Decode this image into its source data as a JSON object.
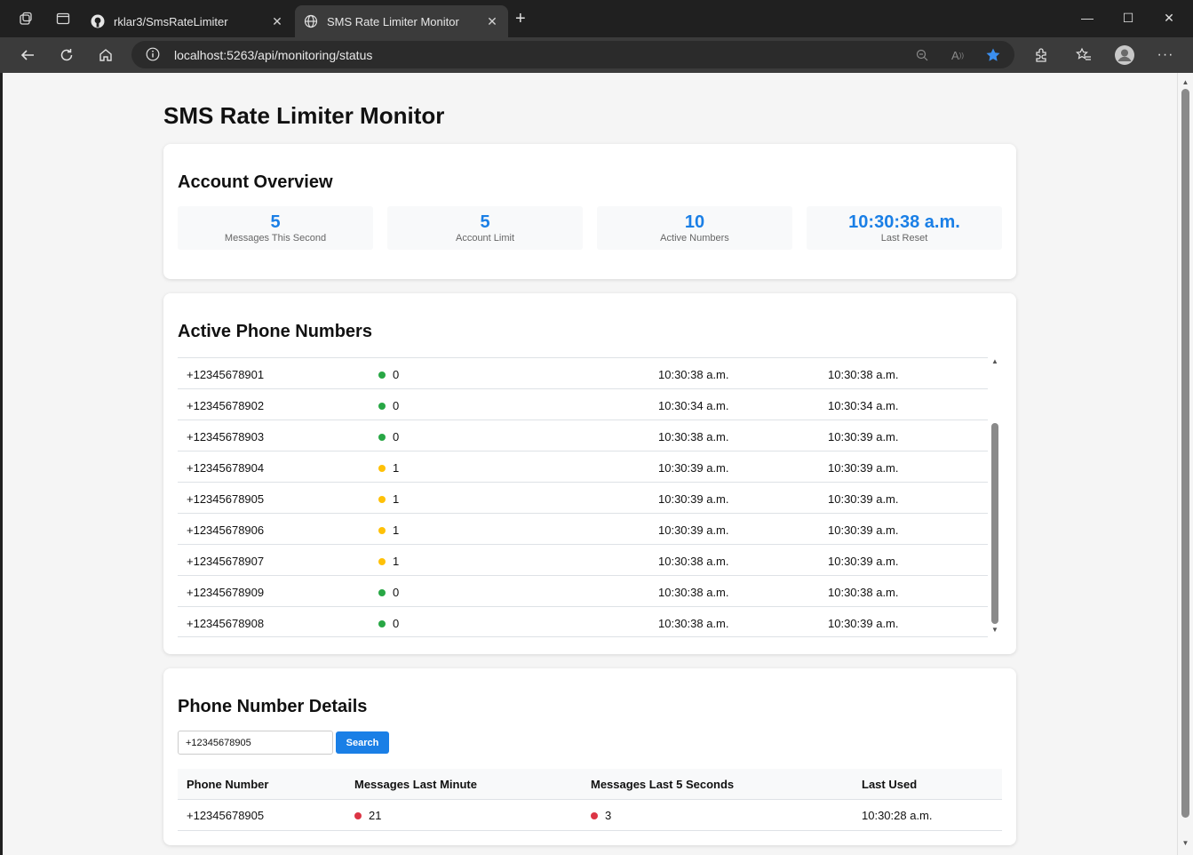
{
  "browser": {
    "tabs": [
      {
        "title": "rklar3/SmsRateLimiter",
        "active": false
      },
      {
        "title": "SMS Rate Limiter Monitor",
        "active": true
      }
    ],
    "url": "localhost:5263/api/monitoring/status"
  },
  "page": {
    "title": "SMS Rate Limiter Monitor"
  },
  "overview": {
    "title": "Account Overview",
    "stats": [
      {
        "value": "5",
        "label": "Messages This Second"
      },
      {
        "value": "5",
        "label": "Account Limit"
      },
      {
        "value": "10",
        "label": "Active Numbers"
      },
      {
        "value": "10:30:38 a.m.",
        "label": "Last Reset"
      }
    ]
  },
  "active_numbers": {
    "title": "Active Phone Numbers",
    "rows": [
      {
        "number": "+12345678901",
        "count": "0",
        "status": "green",
        "t1": "10:30:38 a.m.",
        "t2": "10:30:38 a.m."
      },
      {
        "number": "+12345678902",
        "count": "0",
        "status": "green",
        "t1": "10:30:34 a.m.",
        "t2": "10:30:34 a.m."
      },
      {
        "number": "+12345678903",
        "count": "0",
        "status": "green",
        "t1": "10:30:38 a.m.",
        "t2": "10:30:39 a.m."
      },
      {
        "number": "+12345678904",
        "count": "1",
        "status": "yellow",
        "t1": "10:30:39 a.m.",
        "t2": "10:30:39 a.m."
      },
      {
        "number": "+12345678905",
        "count": "1",
        "status": "yellow",
        "t1": "10:30:39 a.m.",
        "t2": "10:30:39 a.m."
      },
      {
        "number": "+12345678906",
        "count": "1",
        "status": "yellow",
        "t1": "10:30:39 a.m.",
        "t2": "10:30:39 a.m."
      },
      {
        "number": "+12345678907",
        "count": "1",
        "status": "yellow",
        "t1": "10:30:38 a.m.",
        "t2": "10:30:39 a.m."
      },
      {
        "number": "+12345678909",
        "count": "0",
        "status": "green",
        "t1": "10:30:38 a.m.",
        "t2": "10:30:38 a.m."
      },
      {
        "number": "+12345678908",
        "count": "0",
        "status": "green",
        "t1": "10:30:38 a.m.",
        "t2": "10:30:39 a.m."
      }
    ]
  },
  "details": {
    "title": "Phone Number Details",
    "search_value": "+12345678905",
    "search_label": "Search",
    "headers": [
      "Phone Number",
      "Messages Last Minute",
      "Messages Last 5 Seconds",
      "Last Used"
    ],
    "row": {
      "number": "+12345678905",
      "last_minute": "21",
      "last_5s": "3",
      "last_used": "10:30:28 a.m."
    }
  },
  "colors": {
    "green": "#28a745",
    "yellow": "#ffc107",
    "red": "#dc3545",
    "accent": "#1a7fe6"
  }
}
